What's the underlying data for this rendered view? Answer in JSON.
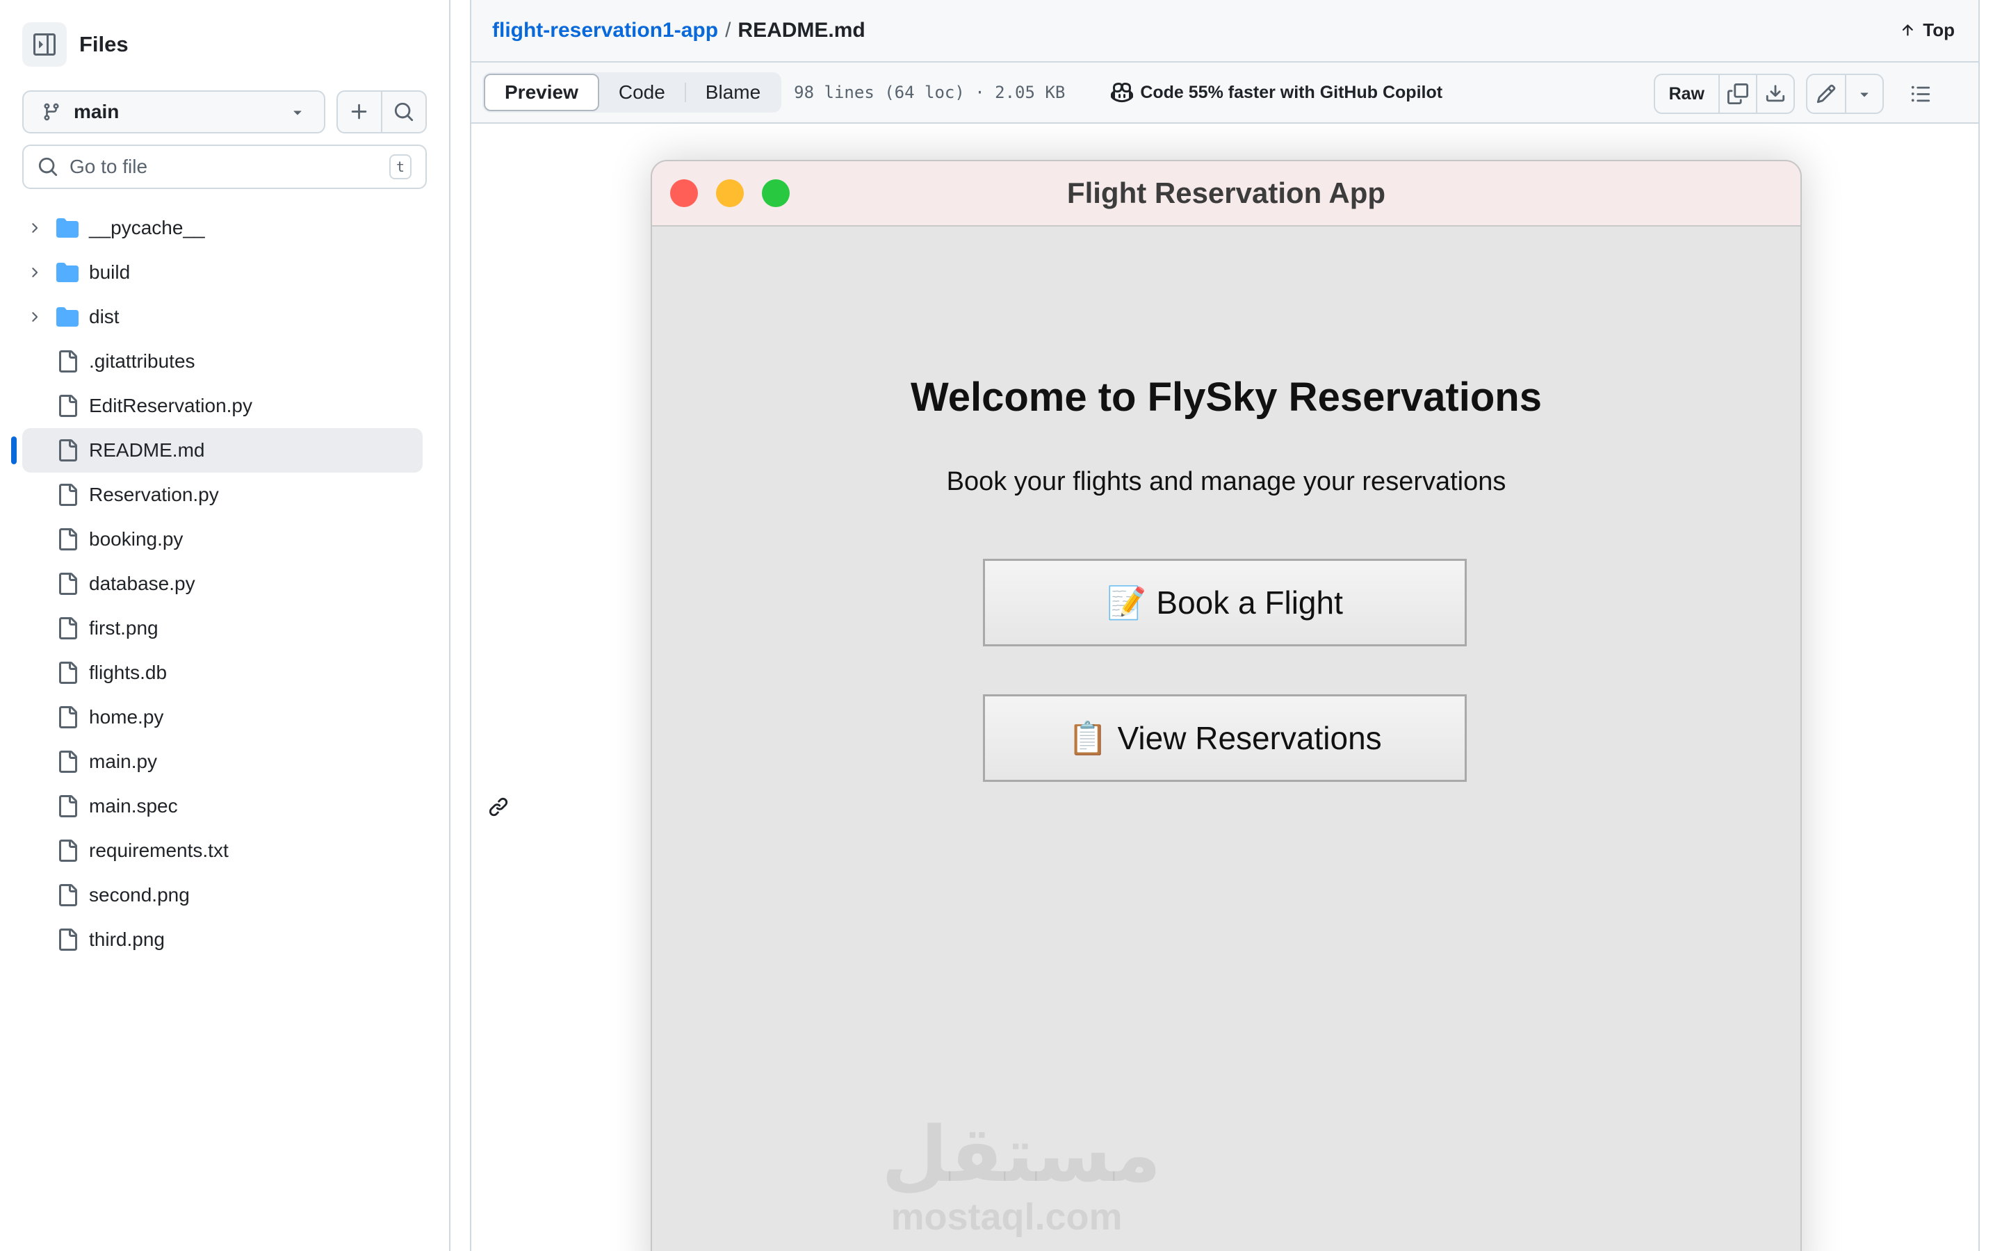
{
  "sidebar": {
    "title": "Files",
    "branch": "main",
    "search_placeholder": "Go to file",
    "search_shortcut": "t",
    "items": [
      {
        "name": "__pycache__",
        "type": "folder"
      },
      {
        "name": "build",
        "type": "folder"
      },
      {
        "name": "dist",
        "type": "folder"
      },
      {
        "name": ".gitattributes",
        "type": "file"
      },
      {
        "name": "EditReservation.py",
        "type": "file"
      },
      {
        "name": "README.md",
        "type": "file",
        "active": true
      },
      {
        "name": "Reservation.py",
        "type": "file"
      },
      {
        "name": "booking.py",
        "type": "file"
      },
      {
        "name": "database.py",
        "type": "file"
      },
      {
        "name": "first.png",
        "type": "file"
      },
      {
        "name": "flights.db",
        "type": "file"
      },
      {
        "name": "home.py",
        "type": "file"
      },
      {
        "name": "main.py",
        "type": "file"
      },
      {
        "name": "main.spec",
        "type": "file"
      },
      {
        "name": "requirements.txt",
        "type": "file"
      },
      {
        "name": "second.png",
        "type": "file"
      },
      {
        "name": "third.png",
        "type": "file"
      }
    ]
  },
  "breadcrumb": {
    "repo": "flight-reservation1-app",
    "separator": "/",
    "file": "README.md",
    "top_label": "Top"
  },
  "file_toolbar": {
    "tabs": [
      "Preview",
      "Code",
      "Blame"
    ],
    "selected_tab": "Preview",
    "meta": "98 lines (64 loc) · 2.05 KB",
    "copilot": "Code 55% faster with GitHub Copilot",
    "raw_label": "Raw"
  },
  "app_window": {
    "title": "Flight Reservation App",
    "heading": "Welcome to FlySky Reservations",
    "subtitle": "Book your flights and manage your reservations",
    "buttons": [
      {
        "emoji": "📝",
        "label": "Book a Flight"
      },
      {
        "emoji": "📋",
        "label": "View Reservations"
      }
    ],
    "watermark_arabic": "مستقل",
    "watermark_latin": "mostaql.com"
  },
  "colors": {
    "link": "#0969da",
    "folder": "#54aeff",
    "active_bar": "#0969da",
    "traffic_red": "#ff5f57",
    "traffic_yellow": "#febc2e",
    "traffic_green": "#28c840"
  },
  "icons": {
    "sidebar_toggle": "sidebar-collapse-icon",
    "branch": "git-branch-icon",
    "add": "plus-icon",
    "search": "search-icon",
    "folder": "folder-icon",
    "file": "file-icon",
    "chevron": "chevron-right-icon",
    "top": "arrow-up-icon",
    "copilot": "copilot-icon",
    "copy": "copy-icon",
    "download": "download-icon",
    "edit": "pencil-icon",
    "more": "triangle-down-icon",
    "outline": "list-unordered-icon",
    "anchor": "link-icon"
  }
}
